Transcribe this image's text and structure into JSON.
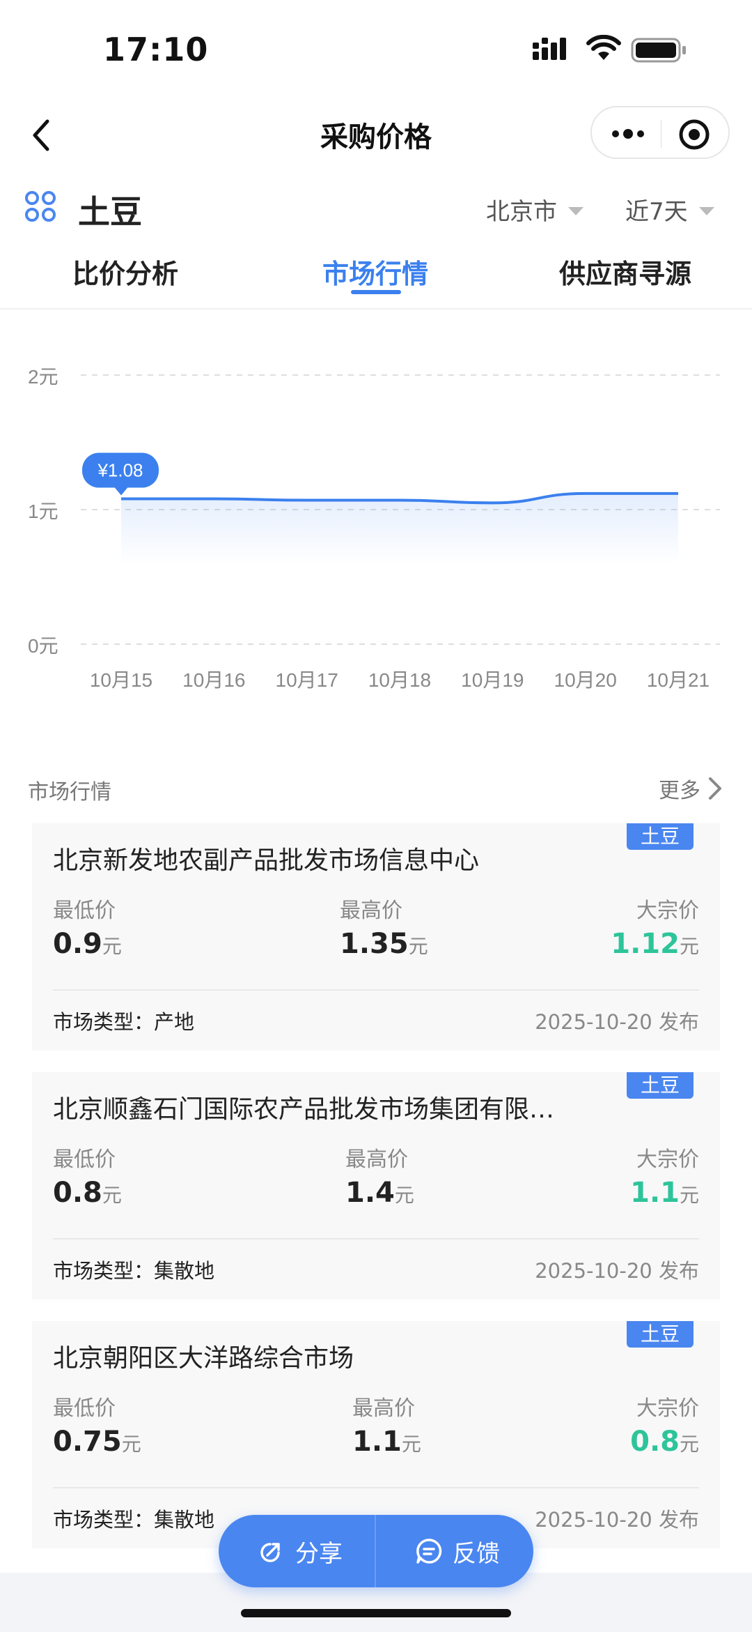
{
  "status_bar": {
    "time": "17:10"
  },
  "navbar": {
    "title": "采购价格"
  },
  "product": {
    "name": "土豆",
    "city": "北京市",
    "range": "近7天"
  },
  "tabs": [
    {
      "label": "比价分析"
    },
    {
      "label": "市场行情"
    },
    {
      "label": "供应商寻源"
    }
  ],
  "active_tab": 1,
  "chart_data": {
    "type": "line",
    "x": [
      "10月15",
      "10月16",
      "10月17",
      "10月18",
      "10月19",
      "10月20",
      "10月21"
    ],
    "series": [
      {
        "values": [
          1.08,
          1.08,
          1.07,
          1.07,
          1.05,
          1.12,
          1.12
        ]
      }
    ],
    "yticks": [
      "0元",
      "1元",
      "2元"
    ],
    "ylim": [
      0,
      2
    ],
    "tooltip": "¥1.08",
    "grid": true,
    "color": "#3b80ee"
  },
  "section": {
    "title": "市场行情",
    "more": "更多"
  },
  "labels": {
    "low": "最低价",
    "high": "最高价",
    "bulk": "大宗价",
    "unit": "元",
    "type_prefix": "市场类型：",
    "publish_suffix": "发布"
  },
  "markets": [
    {
      "tag": "土豆",
      "name": "北京新发地农副产品批发市场信息中心",
      "low": "0.9",
      "high": "1.35",
      "bulk": "1.12",
      "type": "产地",
      "date": "2025-10-20"
    },
    {
      "tag": "土豆",
      "name": "北京顺鑫石门国际农产品批发市场集团有限…",
      "low": "0.8",
      "high": "1.4",
      "bulk": "1.1",
      "type": "集散地",
      "date": "2025-10-20"
    },
    {
      "tag": "土豆",
      "name": "北京朝阳区大洋路综合市场",
      "low": "0.75",
      "high": "1.1",
      "bulk": "0.8",
      "type": "集散地",
      "date": "2025-10-20"
    }
  ],
  "fab": {
    "share": "分享",
    "feedback": "反馈"
  },
  "colors": {
    "accent": "#3b80ee",
    "green": "#2ec49a"
  }
}
